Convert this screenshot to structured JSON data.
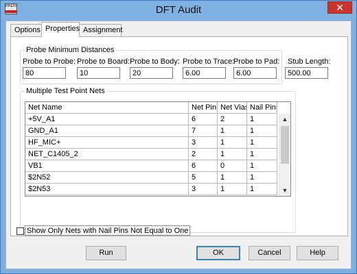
{
  "window": {
    "title": "DFT Audit",
    "icon_label": "PADS",
    "close_glyph": "✕"
  },
  "tabs": [
    {
      "label": "Options"
    },
    {
      "label": "Properties"
    },
    {
      "label": "Assignment"
    }
  ],
  "active_tab": "Properties",
  "probe_distances": {
    "group_title": "Probe Minimum Distances",
    "fields": [
      {
        "label": "Probe to Probe:",
        "value": "80"
      },
      {
        "label": "Probe to Board:",
        "value": "10"
      },
      {
        "label": "Probe to Body:",
        "value": "20"
      },
      {
        "label": "Probe to Trace:",
        "value": "6.00"
      },
      {
        "label": "Probe to Pad:",
        "value": "6.00"
      }
    ],
    "stub_length": {
      "label": "Stub Length:",
      "value": "500.00"
    }
  },
  "nets": {
    "group_title": "Multiple Test Point Nets",
    "columns": [
      "Net Name",
      "Net Pins",
      "Net Vias",
      "Nail Pins"
    ],
    "rows": [
      [
        "+5V_A1",
        "6",
        "2",
        "1"
      ],
      [
        "GND_A1",
        "7",
        "1",
        "1"
      ],
      [
        "HF_MIC+",
        "3",
        "1",
        "1"
      ],
      [
        "NET_C1405_2",
        "2",
        "1",
        "1"
      ],
      [
        "VB1",
        "6",
        "0",
        "1"
      ],
      [
        "$2N52",
        "5",
        "1",
        "1"
      ],
      [
        "$2N53",
        "3",
        "1",
        "1"
      ]
    ],
    "scroll_up_glyph": "▲",
    "scroll_down_glyph": "▼"
  },
  "filter_checkbox": {
    "label": "Show Only Nets with Nail Pins Not Equal to One",
    "checked": false
  },
  "buttons": {
    "run": "Run",
    "ok": "OK",
    "cancel": "Cancel",
    "help": "Help"
  },
  "colors": {
    "titlebar": "#7fb1e3",
    "close_button": "#c7352c",
    "dialog_bg": "#f0f0f0",
    "default_button_border": "#3c7fb1"
  }
}
